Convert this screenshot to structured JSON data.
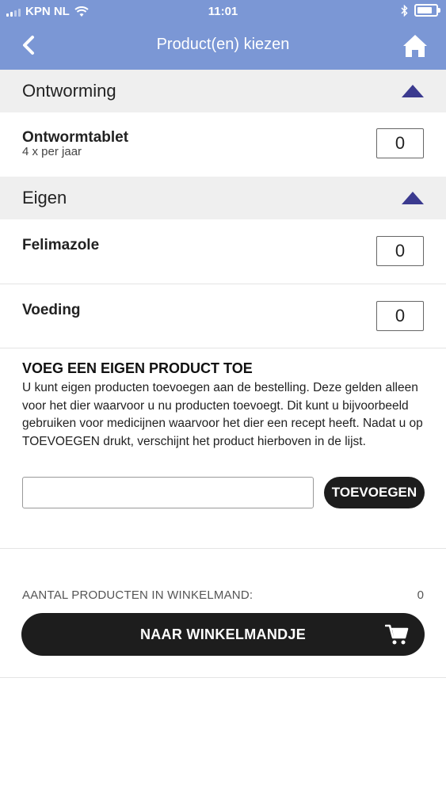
{
  "status_bar": {
    "carrier": "KPN NL",
    "time": "11:01"
  },
  "nav": {
    "title": "Product(en) kiezen",
    "back_icon": "chevron-left-icon",
    "home_icon": "home-icon"
  },
  "sections": [
    {
      "label": "Ontworming",
      "items": [
        {
          "name": "Ontwormtablet",
          "subtitle": "4 x per jaar",
          "quantity": "0"
        }
      ]
    },
    {
      "label": "Eigen",
      "items": [
        {
          "name": "Felimazole",
          "quantity": "0"
        },
        {
          "name": "Voeding",
          "quantity": "0"
        }
      ]
    }
  ],
  "add_product": {
    "title": "VOEG EEN EIGEN PRODUCT TOE",
    "description": "U kunt eigen producten toevoegen aan de bestelling. Deze gelden alleen voor het dier waarvoor u nu producten toevoegt. Dit kunt u bijvoorbeeld gebruiken voor medicijnen waarvoor het dier een recept heeft. Nadat u op TOEVOEGEN drukt, verschijnt het product hierboven in de lijst.",
    "input_value": "",
    "button_label": "TOEVOEGEN"
  },
  "cart": {
    "count_label": "AANTAL PRODUCTEN IN WINKELMAND:",
    "count_value": "0",
    "button_label": "NAAR WINKELMANDJE",
    "icon": "shopping-cart-icon"
  },
  "colors": {
    "header": "#7b97d5",
    "accent_triangle": "#3b3a8f",
    "section_bg": "#efefef",
    "button_bg": "#1d1d1d"
  }
}
